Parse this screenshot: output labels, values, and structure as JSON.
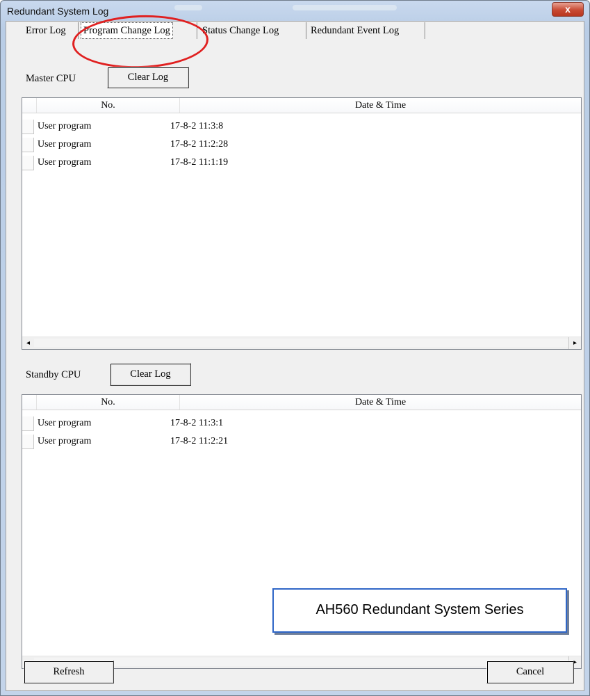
{
  "window": {
    "title": "Redundant System Log",
    "close_label": "x"
  },
  "tabs": [
    {
      "label": "Error Log",
      "active": false
    },
    {
      "label": "Program Change Log",
      "active": true
    },
    {
      "label": "Status Change Log",
      "active": false
    },
    {
      "label": "Redundant Event Log",
      "active": false
    }
  ],
  "master": {
    "label": "Master CPU",
    "clear_label": "Clear Log",
    "columns": [
      "No.",
      "Date & Time"
    ],
    "rows": [
      {
        "no": "User program",
        "datetime": "17-8-2  11:3:8"
      },
      {
        "no": "User program",
        "datetime": "17-8-2  11:2:28"
      },
      {
        "no": "User program",
        "datetime": "17-8-2  11:1:19"
      }
    ]
  },
  "standby": {
    "label": "Standby CPU",
    "clear_label": "Clear Log",
    "columns": [
      "No.",
      "Date & Time"
    ],
    "rows": [
      {
        "no": "User program",
        "datetime": "17-8-2  11:3:1"
      },
      {
        "no": "User program",
        "datetime": "17-8-2  11:2:21"
      }
    ]
  },
  "footer": {
    "refresh_label": "Refresh",
    "cancel_label": "Cancel"
  },
  "annotation": {
    "text": "AH560 Redundant System Series",
    "highlight_color": "#e02020"
  },
  "icons": {
    "scroll_left": "◂",
    "scroll_right": "▸"
  }
}
